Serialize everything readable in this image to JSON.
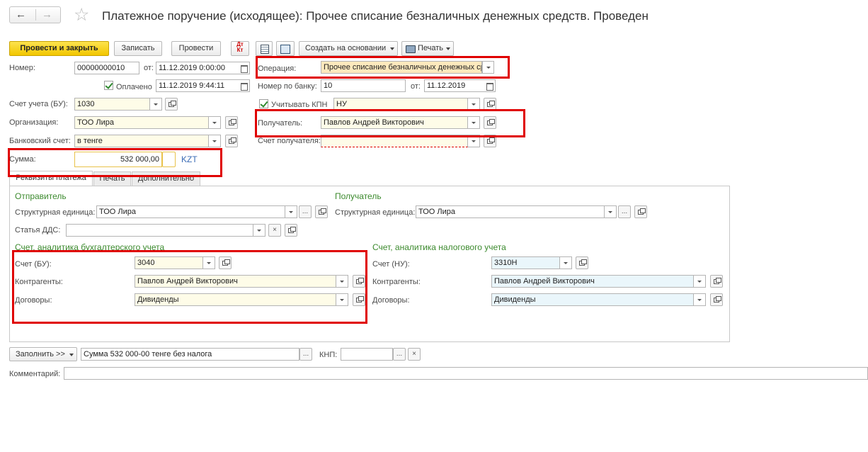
{
  "nav": {
    "back": "←",
    "forward": "→",
    "star": "☆"
  },
  "title": "Платежное поручение (исходящее): Прочее списание безналичных денежных средств. Проведен",
  "toolbar": {
    "post_close": "Провести и закрыть",
    "save": "Записать",
    "post": "Провести",
    "dtkt": "Дт Кт",
    "create_based": "Создать на основании",
    "print": "Печать"
  },
  "header": {
    "number_label": "Номер:",
    "number": "00000000010",
    "from_label": "от:",
    "date": "11.12.2019  0:00:00",
    "paid_label": "Оплачено",
    "paid_date": "11.12.2019  9:44:11",
    "operation_label": "Операция:",
    "operation": "Прочее списание безналичных денежных ср",
    "bank_num_label": "Номер по банку:",
    "bank_num": "10",
    "bank_from_label": "от:",
    "bank_date": "11.12.2019",
    "account_label": "Счет учета (БУ):",
    "account": "1030",
    "kpn_label": "Учитывать КПН",
    "kpn_value": "НУ",
    "org_label": "Организация:",
    "org": "ТОО  Лира",
    "recipient_label": "Получатель:",
    "recipient": "Павлов Андрей Викторович",
    "bank_acc_label": "Банковский счет:",
    "bank_acc": "в тенге",
    "recipient_acc_label": "Счет получателя:",
    "recipient_acc": "",
    "sum_label": "Сумма:",
    "sum": "532 000,00",
    "currency": "KZT"
  },
  "tabs": [
    "Реквизиты платежа",
    "Печать",
    "Дополнительно"
  ],
  "sender": {
    "title": "Отправитель",
    "unit_label": "Структурная единица:",
    "unit": "ТОО  Лира",
    "dds_label": "Статья ДДС:",
    "dds": ""
  },
  "receiver": {
    "title": "Получатель",
    "unit_label": "Структурная единица:",
    "unit": "ТОО  Лира"
  },
  "bu": {
    "title": "Счет, аналитика бухгалтерского учета",
    "account_label": "Счет (БУ):",
    "account": "3040",
    "contr_label": "Контрагенты:",
    "contr": "Павлов Андрей Викторович",
    "contracts_label": "Договоры:",
    "contracts": "Дивиденды"
  },
  "nu": {
    "title": "Счет, аналитика налогового учета",
    "account_label": "Счет (НУ):",
    "account": "3310Н",
    "contr_label": "Контрагенты:",
    "contr": "Павлов Андрей Викторович",
    "contracts_label": "Договоры:",
    "contracts": "Дивиденды"
  },
  "footer": {
    "fill_btn": "Заполнить >>",
    "purpose": "Сумма 532 000-00  тенге  без налога",
    "knp_label": "КНП:",
    "knp": "",
    "comment_label": "Комментарий:",
    "comment": ""
  },
  "icons": {
    "dots": "...",
    "clear": "×"
  }
}
